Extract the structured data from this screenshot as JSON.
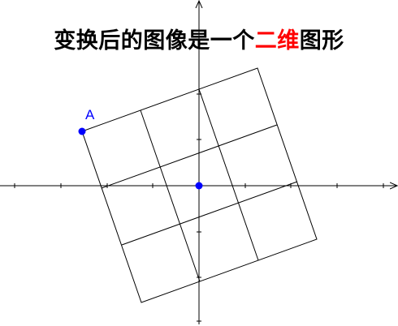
{
  "title": {
    "before": "变换后的图像是一个",
    "highlight": "二维",
    "after": "图形"
  },
  "point_label": "A",
  "colors": {
    "highlight": "#ff0000",
    "point": "#0000ff",
    "lines": "#000000"
  }
}
